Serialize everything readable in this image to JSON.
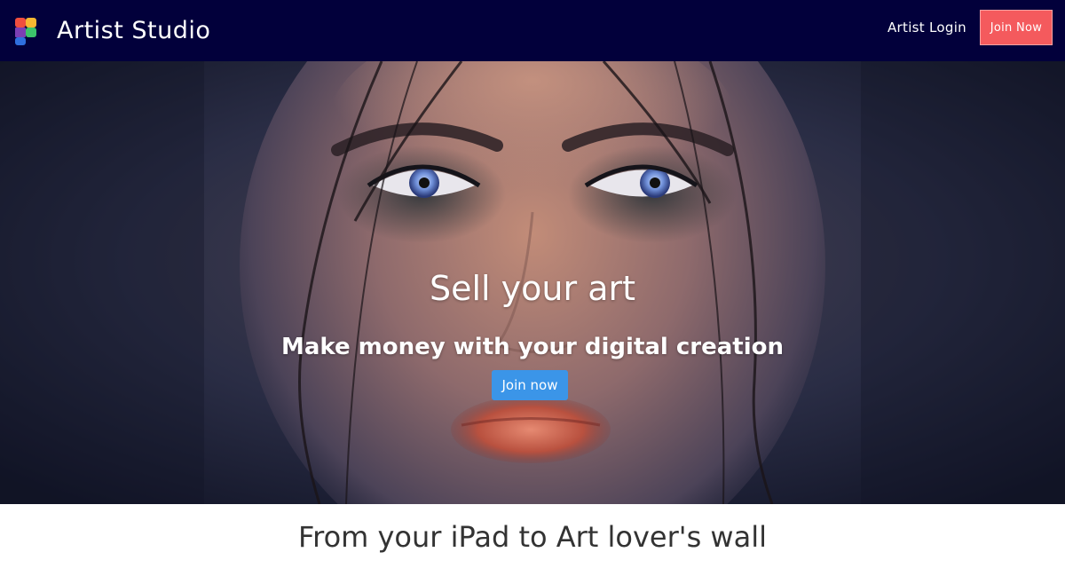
{
  "brand": {
    "logo_icon": "multicolor-p-logo-icon",
    "name": "Artist Studio"
  },
  "nav": {
    "login_label": "Artist Login",
    "join_label": "Join Now"
  },
  "hero": {
    "image": "painted-portrait-hero-image",
    "title": "Sell your art",
    "subtitle": "Make money with your digital creation",
    "cta_label": "Join now"
  },
  "section": {
    "heading": "From your iPad to Art lover's wall"
  },
  "colors": {
    "navbar": "#02003b",
    "join_button": "#f45a5d",
    "cta_button": "#3b95e8",
    "heading_text": "#333333"
  }
}
